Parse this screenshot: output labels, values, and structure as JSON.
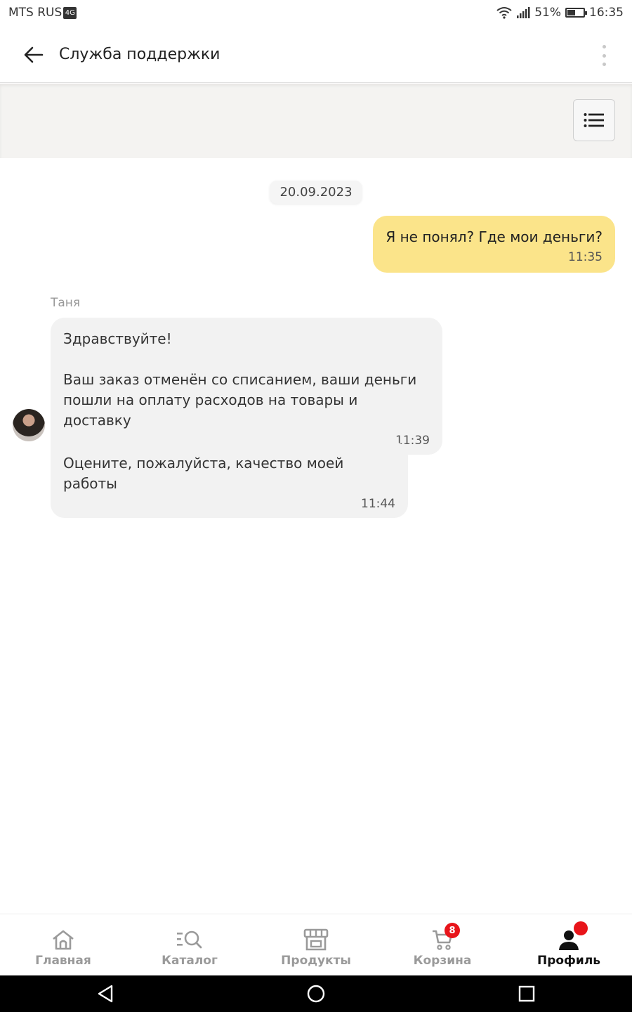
{
  "status_bar": {
    "carrier": "MTS RUS",
    "carrier_logo": "4G",
    "battery": "51%",
    "battery_level": 0.51,
    "time": "16:35"
  },
  "header": {
    "title": "Служба поддержки"
  },
  "chat": {
    "date": "20.09.2023",
    "outgoing": {
      "text": "Я не понял? Где мои деньги?",
      "time": "11:35"
    },
    "agent_name": "Таня",
    "incoming": [
      {
        "text": "Здравствуйте!\n\nВаш заказ отменён со списанием, ваши деньги\nпошли на оплату расходов на товары и доставку",
        "time": "11:39"
      },
      {
        "text": "Оцените, пожалуйста, качество моей работы",
        "time": "11:44"
      }
    ]
  },
  "nav": {
    "home": "Главная",
    "catalog": "Каталог",
    "products": "Продукты",
    "cart": "Корзина",
    "cart_badge": "8",
    "profile": "Профиль"
  },
  "colors": {
    "outgoing_bubble": "#fbe48a",
    "incoming_bubble": "#f2f2f2",
    "badge": "#e8141a"
  }
}
